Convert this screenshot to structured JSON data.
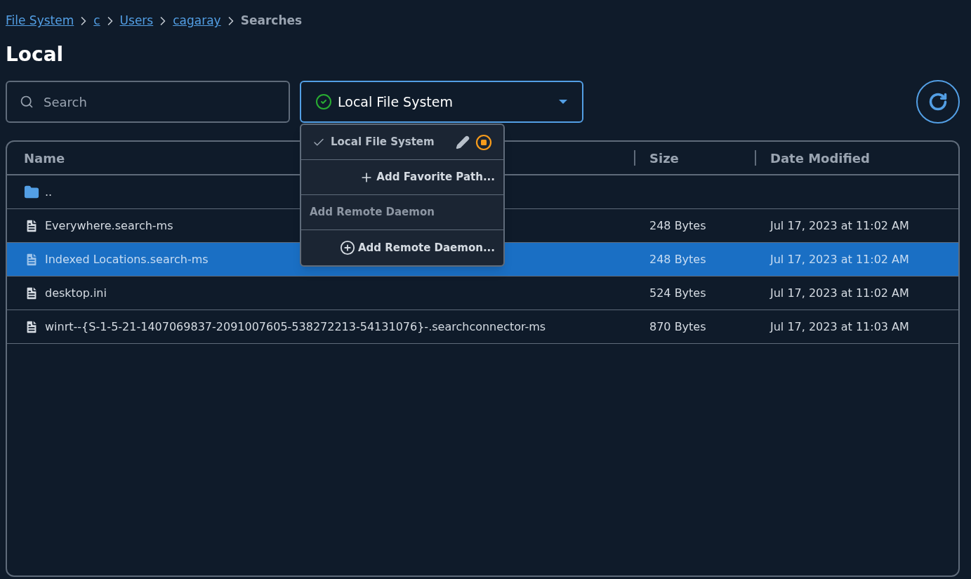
{
  "breadcrumb": [
    {
      "label": "File System",
      "kind": "link"
    },
    {
      "label": "c",
      "kind": "link"
    },
    {
      "label": "Users",
      "kind": "link"
    },
    {
      "label": "cagaray",
      "kind": "link"
    },
    {
      "label": "Searches",
      "kind": "current"
    }
  ],
  "title": "Local",
  "search": {
    "placeholder": "Search"
  },
  "source_select": {
    "value": "Local File System",
    "expanded": true
  },
  "menu": [
    {
      "kind": "option",
      "label": "Local File System",
      "selected": true
    },
    {
      "kind": "add-path",
      "label": "Add Favorite Path..."
    },
    {
      "kind": "header",
      "label": "Add Remote Daemon"
    },
    {
      "kind": "add-daemon",
      "label": "Add Remote Daemon..."
    }
  ],
  "table": {
    "columns": [
      "Name",
      "Size",
      "Date Modified"
    ],
    "rows": [
      {
        "kind": "folder",
        "name": "..",
        "selected": false
      },
      {
        "kind": "file",
        "name": "Everywhere.search-ms",
        "size": "248 Bytes",
        "date": "Jul 17, 2023 at 11:02 AM",
        "selected": false
      },
      {
        "kind": "file",
        "name": "Indexed Locations.search-ms",
        "size": "248 Bytes",
        "date": "Jul 17, 2023 at 11:02 AM",
        "selected": true
      },
      {
        "kind": "file",
        "name": "desktop.ini",
        "size": "524 Bytes",
        "date": "Jul 17, 2023 at 11:02 AM",
        "selected": false
      },
      {
        "kind": "file",
        "name": "winrt--{S-1-5-21-1407069837-2091007605-538272213-54131076}-.searchconnector-ms",
        "size": "870 Bytes",
        "date": "Jul 17, 2023 at 11:03 AM",
        "selected": false
      }
    ]
  }
}
